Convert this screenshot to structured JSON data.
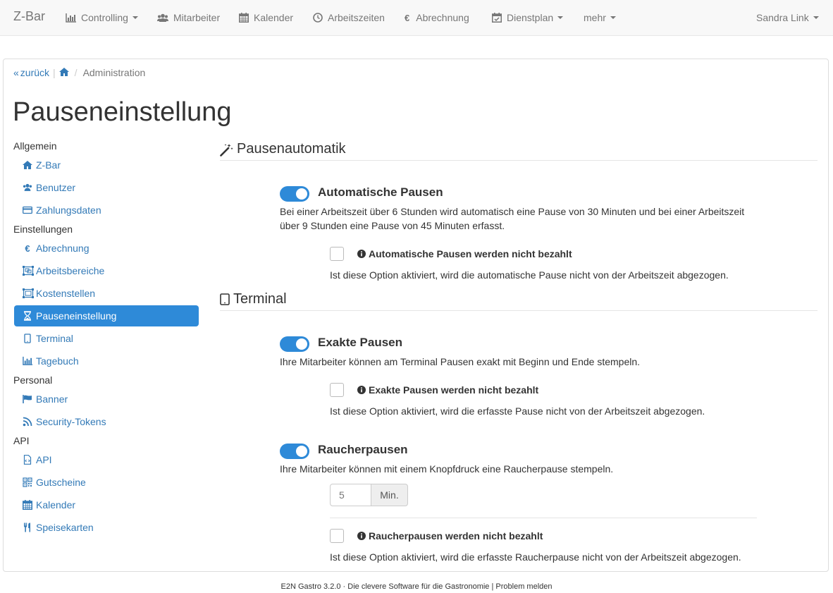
{
  "navbar": {
    "brand": "Z-Bar",
    "items": [
      {
        "label": "Controlling",
        "icon": "bar-chart-icon"
      },
      {
        "label": "Mitarbeiter",
        "icon": "users-icon"
      },
      {
        "label": "Kalender",
        "icon": "calendar-icon"
      },
      {
        "label": "Arbeitszeiten",
        "icon": "clock-icon"
      },
      {
        "label": "Abrechnung",
        "icon": "euro-icon"
      },
      {
        "label": "Dienstplan",
        "icon": "calendar-check-icon"
      },
      {
        "label": "mehr",
        "icon": ""
      }
    ],
    "user": "Sandra Link"
  },
  "breadcrumb": {
    "back": "zurück",
    "separator": "/",
    "current": "Administration"
  },
  "page_title": "Pauseneinstellung",
  "sidebar": {
    "groups": [
      {
        "heading": "Allgemein",
        "items": [
          {
            "label": "Z-Bar",
            "icon": "home-icon"
          },
          {
            "label": "Benutzer",
            "icon": "users-icon"
          },
          {
            "label": "Zahlungsdaten",
            "icon": "credit-card-icon"
          }
        ]
      },
      {
        "heading": "Einstellungen",
        "items": [
          {
            "label": "Abrechnung",
            "icon": "euro-icon"
          },
          {
            "label": "Arbeitsbereiche",
            "icon": "object-group-icon"
          },
          {
            "label": "Kostenstellen",
            "icon": "object-ungroup-icon"
          },
          {
            "label": "Pauseneinstellung",
            "icon": "hourglass-icon",
            "active": true
          },
          {
            "label": "Terminal",
            "icon": "tablet-icon"
          },
          {
            "label": "Tagebuch",
            "icon": "bar-chart-icon"
          }
        ]
      },
      {
        "heading": "Personal",
        "items": [
          {
            "label": "Banner",
            "icon": "flag-icon"
          },
          {
            "label": "Security-Tokens",
            "icon": "rss-icon"
          }
        ]
      },
      {
        "heading": "API",
        "items": [
          {
            "label": "API",
            "icon": "file-code-icon"
          },
          {
            "label": "Gutscheine",
            "icon": "qrcode-icon"
          },
          {
            "label": "Kalender",
            "icon": "calendar-icon"
          },
          {
            "label": "Speisekarten",
            "icon": "cutlery-icon"
          }
        ]
      }
    ]
  },
  "sections": {
    "pausenautomatik": {
      "title": "Pausenautomatik",
      "icon": "magic-wand-icon",
      "toggle_on": true,
      "option_title": "Automatische Pausen",
      "description": "Bei einer Arbeitszeit über 6 Stunden wird automatisch eine Pause von 30 Minuten und bei einer Arbeitszeit über 9 Stunden eine Pause von 45 Minuten erfasst.",
      "checkbox_checked": false,
      "checkbox_label": "Automatische Pausen werden nicht bezahlt",
      "checkbox_desc": "Ist diese Option aktiviert, wird die automatische Pause nicht von der Arbeitszeit abgezogen."
    },
    "terminal": {
      "title": "Terminal",
      "icon": "tablet-icon",
      "exakte": {
        "toggle_on": true,
        "option_title": "Exakte Pausen",
        "description": "Ihre Mitarbeiter können am Terminal Pausen exakt mit Beginn und Ende stempeln.",
        "checkbox_checked": false,
        "checkbox_label": "Exakte Pausen werden nicht bezahlt",
        "checkbox_desc": "Ist diese Option aktiviert, wird die erfasste Pause nicht von der Arbeitszeit abgezogen."
      },
      "raucher": {
        "toggle_on": true,
        "option_title": "Raucherpausen",
        "description": "Ihre Mitarbeiter können mit einem Knopfdruck eine Raucherpause stempeln.",
        "minutes_value": "5",
        "minutes_unit": "Min.",
        "checkbox_checked": false,
        "checkbox_label": "Raucherpausen werden nicht bezahlt",
        "checkbox_desc": "Ist diese Option aktiviert, wird die erfasste Raucherpause nicht von der Arbeitszeit abgezogen."
      }
    }
  },
  "footer": {
    "text": "E2N Gastro 3.2.0 · Die clevere Software für die Gastronomie | ",
    "link": "Problem melden"
  },
  "colors": {
    "link": "#337ab7",
    "accent": "#2e8ad8",
    "navbar_bg": "#f8f8f8"
  }
}
